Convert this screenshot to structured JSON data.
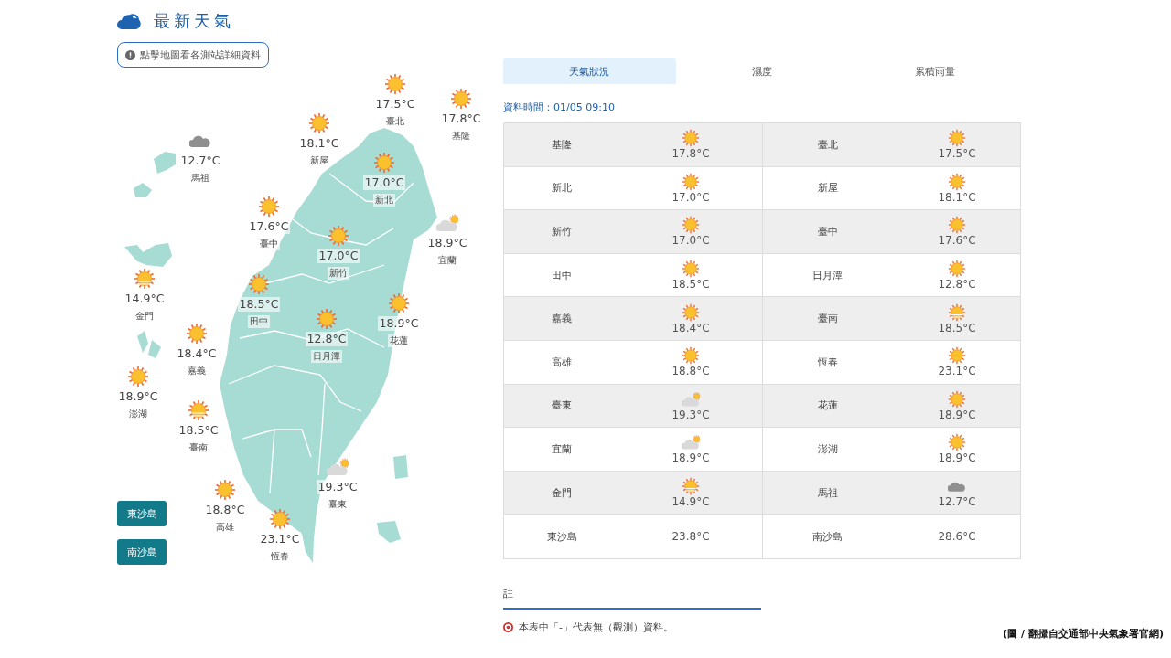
{
  "header": {
    "title": "最新天氣",
    "map_hint_button": "點擊地圖看各測站詳細資料"
  },
  "map": {
    "stations": [
      {
        "name": "臺北",
        "temp": "17.5°C",
        "kind": "sunny"
      },
      {
        "name": "基隆",
        "temp": "17.8°C",
        "kind": "sunny"
      },
      {
        "name": "新屋",
        "temp": "18.1°C",
        "kind": "sunny"
      },
      {
        "name": "馬祖",
        "temp": "12.7°C",
        "kind": "cloudy"
      },
      {
        "name": "新北",
        "temp": "17.0°C",
        "kind": "sunny"
      },
      {
        "name": "臺中",
        "temp": "17.6°C",
        "kind": "sunny"
      },
      {
        "name": "新竹",
        "temp": "17.0°C",
        "kind": "sunny"
      },
      {
        "name": "宜蘭",
        "temp": "18.9°C",
        "kind": "partly_cloudy"
      },
      {
        "name": "金門",
        "temp": "14.9°C",
        "kind": "hazy_sunny"
      },
      {
        "name": "田中",
        "temp": "18.5°C",
        "kind": "sunny"
      },
      {
        "name": "花蓮",
        "temp": "18.9°C",
        "kind": "sunny"
      },
      {
        "name": "日月潭",
        "temp": "12.8°C",
        "kind": "sunny"
      },
      {
        "name": "嘉義",
        "temp": "18.4°C",
        "kind": "sunny"
      },
      {
        "name": "澎湖",
        "temp": "18.9°C",
        "kind": "sunny"
      },
      {
        "name": "臺南",
        "temp": "18.5°C",
        "kind": "hazy_sunny"
      },
      {
        "name": "臺東",
        "temp": "19.3°C",
        "kind": "partly_cloudy"
      },
      {
        "name": "高雄",
        "temp": "18.8°C",
        "kind": "sunny"
      },
      {
        "name": "恆春",
        "temp": "23.1°C",
        "kind": "sunny"
      }
    ],
    "island_buttons": [
      "東沙島",
      "南沙島"
    ]
  },
  "tabs": [
    {
      "label": "天氣狀況",
      "selected": true
    },
    {
      "label": "濕度",
      "selected": false
    },
    {
      "label": "累積雨量",
      "selected": false
    }
  ],
  "data_time": "資料時間：01/05 09:10",
  "table": {
    "rows": [
      [
        {
          "name": "基隆",
          "temp": "17.8°C",
          "kind": "sunny"
        },
        {
          "name": "臺北",
          "temp": "17.5°C",
          "kind": "sunny"
        }
      ],
      [
        {
          "name": "新北",
          "temp": "17.0°C",
          "kind": "sunny"
        },
        {
          "name": "新屋",
          "temp": "18.1°C",
          "kind": "sunny"
        }
      ],
      [
        {
          "name": "新竹",
          "temp": "17.0°C",
          "kind": "sunny"
        },
        {
          "name": "臺中",
          "temp": "17.6°C",
          "kind": "sunny"
        }
      ],
      [
        {
          "name": "田中",
          "temp": "18.5°C",
          "kind": "sunny"
        },
        {
          "name": "日月潭",
          "temp": "12.8°C",
          "kind": "sunny"
        }
      ],
      [
        {
          "name": "嘉義",
          "temp": "18.4°C",
          "kind": "sunny"
        },
        {
          "name": "臺南",
          "temp": "18.5°C",
          "kind": "hazy_sunny"
        }
      ],
      [
        {
          "name": "高雄",
          "temp": "18.8°C",
          "kind": "sunny"
        },
        {
          "name": "恆春",
          "temp": "23.1°C",
          "kind": "sunny"
        }
      ],
      [
        {
          "name": "臺東",
          "temp": "19.3°C",
          "kind": "partly_cloudy"
        },
        {
          "name": "花蓮",
          "temp": "18.9°C",
          "kind": "sunny"
        }
      ],
      [
        {
          "name": "宜蘭",
          "temp": "18.9°C",
          "kind": "partly_cloudy"
        },
        {
          "name": "澎湖",
          "temp": "18.9°C",
          "kind": "sunny"
        }
      ],
      [
        {
          "name": "金門",
          "temp": "14.9°C",
          "kind": "hazy_sunny"
        },
        {
          "name": "馬祖",
          "temp": "12.7°C",
          "kind": "cloudy"
        }
      ],
      [
        {
          "name": "東沙島",
          "temp": "23.8°C"
        },
        {
          "name": "南沙島",
          "temp": "28.6°C"
        }
      ]
    ]
  },
  "notes": {
    "title": "註",
    "items": [
      "本表中「-」代表無（觀測）資料。"
    ]
  },
  "image_credit": "(圖 / 翻攝自交通部中央氣象署官網)"
}
